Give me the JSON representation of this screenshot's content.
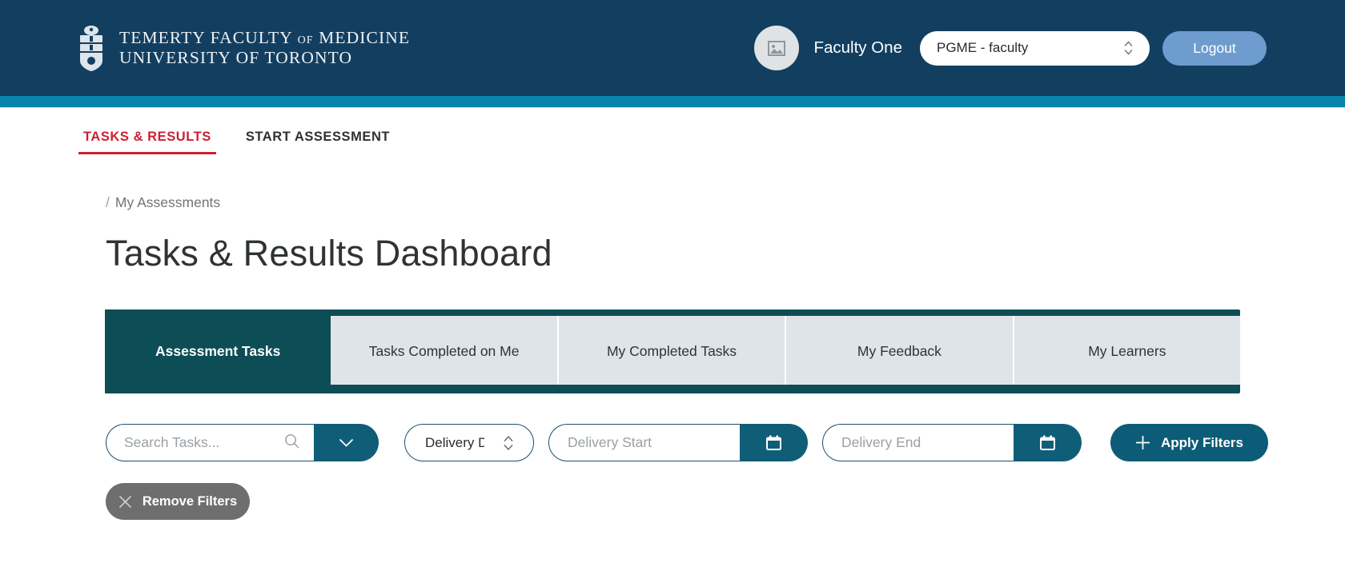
{
  "brand": {
    "logo_line1": "TEMERTY FACULTY",
    "logo_of": "OF",
    "logo_line1_end": "MEDICINE",
    "logo_line2": "UNIVERSITY OF TORONTO",
    "crest_icon": "university-crest-icon"
  },
  "header": {
    "avatar_icon": "image-placeholder-icon",
    "user_name": "Faculty One",
    "role_value": "PGME - faculty",
    "role_stepper_icon": "stepper-up-down-icon",
    "logout_label": "Logout"
  },
  "nav": {
    "items": [
      {
        "label": "TASKS & RESULTS",
        "active": true
      },
      {
        "label": "START ASSESSMENT",
        "active": false
      }
    ]
  },
  "breadcrumb": {
    "separator": "/",
    "current": "My Assessments"
  },
  "page": {
    "title": "Tasks & Results Dashboard"
  },
  "tabs": [
    {
      "label": "Assessment Tasks",
      "active": true
    },
    {
      "label": "Tasks Completed on Me",
      "active": false
    },
    {
      "label": "My Completed Tasks",
      "active": false
    },
    {
      "label": "My Feedback",
      "active": false
    },
    {
      "label": "My Learners",
      "active": false
    }
  ],
  "filters": {
    "search_placeholder": "Search Tasks...",
    "search_value": "",
    "search_icon": "search-icon",
    "search_dropdown_icon": "chevron-down-icon",
    "sort_value": "Delivery Date",
    "sort_stepper_icon": "stepper-up-down-icon",
    "delivery_start_placeholder": "Delivery Start",
    "delivery_start_value": "",
    "delivery_end_placeholder": "Delivery End",
    "delivery_end_value": "",
    "calendar_icon": "calendar-icon",
    "apply_label": "Apply Filters",
    "apply_icon": "plus-icon",
    "remove_label": "Remove Filters",
    "remove_icon": "close-x-icon"
  },
  "colors": {
    "header_navy": "#123f60",
    "teal_band": "#0a84ab",
    "accent_red": "#cc2030",
    "tab_active": "#0d4d56",
    "tab_inactive": "#dfe4e8",
    "button_teal": "#0c5c77",
    "logout_blue": "#6f9ccf",
    "remove_gray": "#6e6e6e"
  }
}
